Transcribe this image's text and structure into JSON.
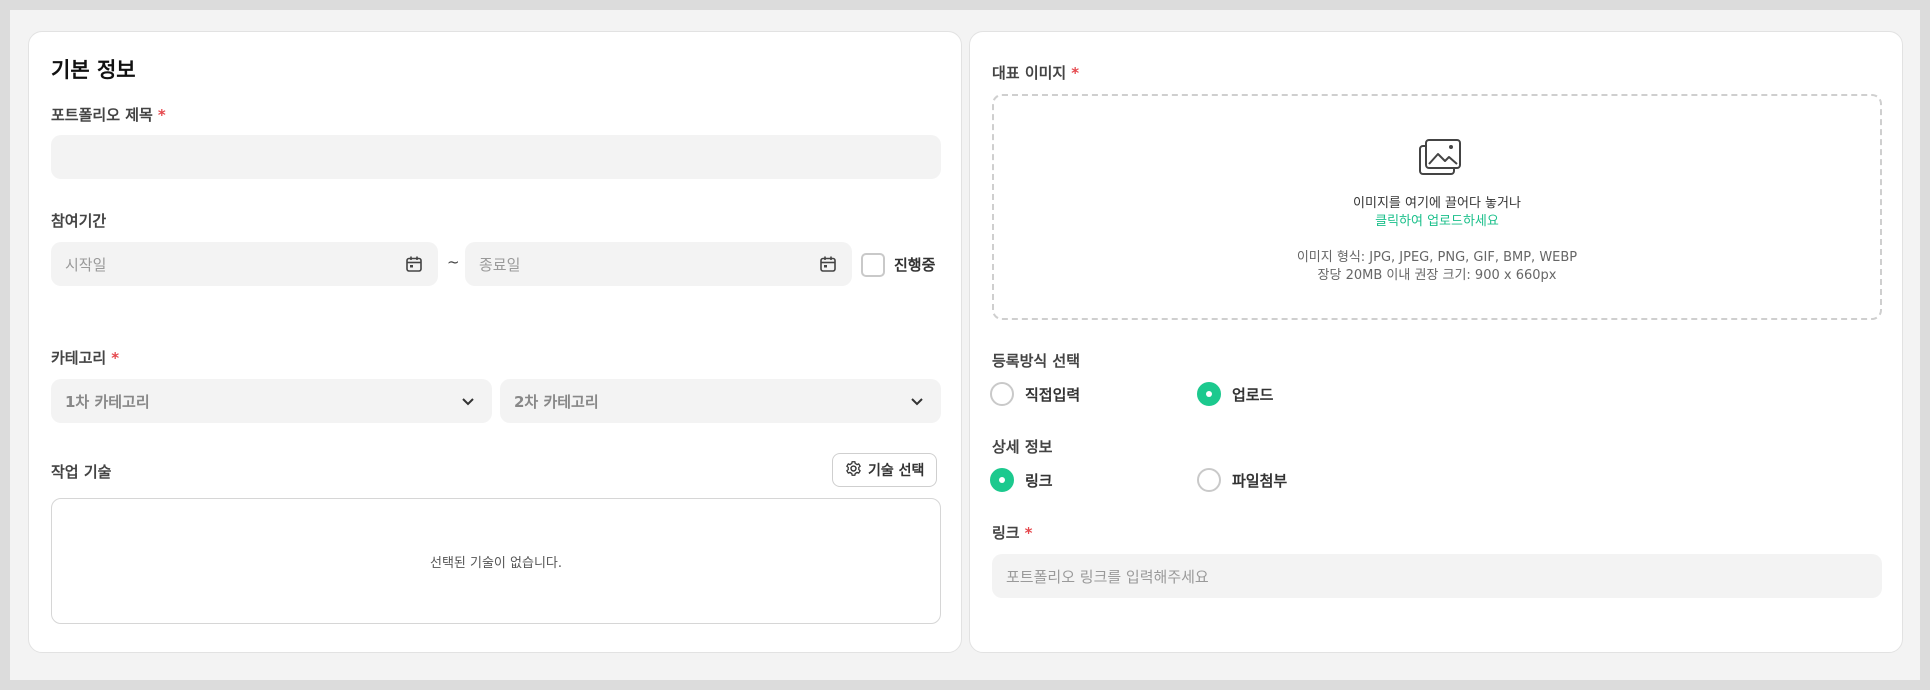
{
  "basic_info": {
    "section_title": "기본 정보",
    "portfolio_title": {
      "label": "포트폴리오 제목",
      "required": "*",
      "value": ""
    },
    "period": {
      "label": "참여기간",
      "start_placeholder": "시작일",
      "end_placeholder": "종료일",
      "separator": "~",
      "ongoing_label": "진행중",
      "ongoing_checked": false
    },
    "category": {
      "label": "카테고리",
      "required": "*",
      "primary_placeholder": "1차 카테고리",
      "secondary_placeholder": "2차 카테고리"
    },
    "skills": {
      "label": "작업 기술",
      "select_button": "기술 선택",
      "empty_text": "선택된 기술이 없습니다."
    }
  },
  "media": {
    "thumbnail": {
      "label": "대표 이미지",
      "required": "*",
      "drop_text": "이미지를 여기에 끌어다 놓거나",
      "click_text": "클릭하여 업로드하세요",
      "format_hint": "이미지 형식: JPG, JPEG, PNG, GIF, BMP, WEBP",
      "size_hint": "장당 20MB 이내 권장 크기: 900 x 660px"
    },
    "register_method": {
      "label": "등록방식 선택",
      "options": [
        {
          "label": "직접입력",
          "selected": false
        },
        {
          "label": "업로드",
          "selected": true
        }
      ]
    },
    "detail_info": {
      "label": "상세 정보",
      "options": [
        {
          "label": "링크",
          "selected": true
        },
        {
          "label": "파일첨부",
          "selected": false
        }
      ]
    },
    "link": {
      "label": "링크",
      "required": "*",
      "placeholder": "포트폴리오 링크를 입력해주세요"
    }
  },
  "colors": {
    "accent": "#1cc98e",
    "required": "#e5484d",
    "input_bg": "#f3f3f3"
  },
  "icons": {
    "calendar": "calendar-icon",
    "chevron": "chevron-down-icon",
    "gear": "gear-icon",
    "image": "image-icon"
  }
}
